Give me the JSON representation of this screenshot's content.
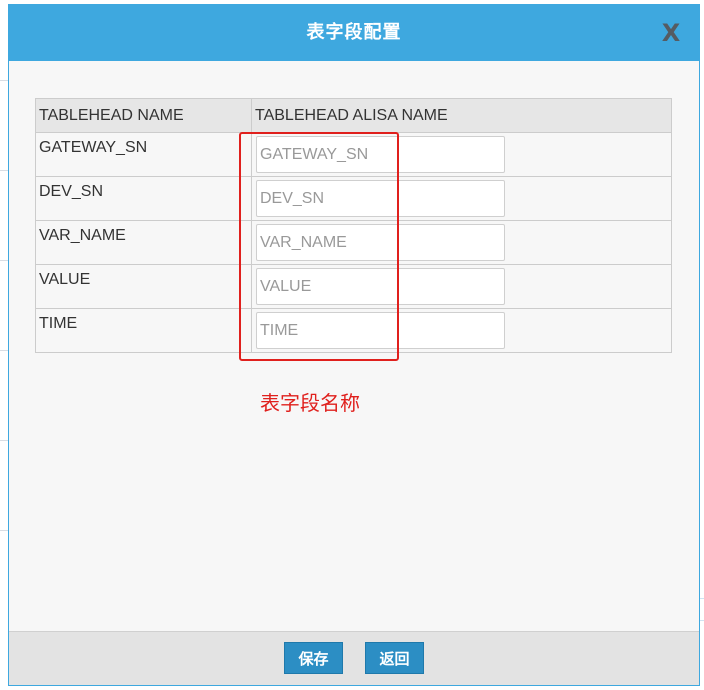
{
  "dialog": {
    "title": "表字段配置",
    "close_label": "X"
  },
  "table": {
    "headers": [
      "TABLEHEAD NAME",
      "TABLEHEAD ALISA NAME"
    ],
    "rows": [
      {
        "name": "GATEWAY_SN",
        "alias_placeholder": "GATEWAY_SN",
        "alias_value": ""
      },
      {
        "name": "DEV_SN",
        "alias_placeholder": "DEV_SN",
        "alias_value": ""
      },
      {
        "name": "VAR_NAME",
        "alias_placeholder": "VAR_NAME",
        "alias_value": ""
      },
      {
        "name": "VALUE",
        "alias_placeholder": "VALUE",
        "alias_value": ""
      },
      {
        "name": "TIME",
        "alias_placeholder": "TIME",
        "alias_value": ""
      }
    ]
  },
  "annotation": {
    "text": "表字段名称",
    "color": "#e0201d"
  },
  "footer": {
    "save_label": "保存",
    "back_label": "返回"
  },
  "colors": {
    "header_bg": "#3ea8df",
    "button_bg": "#2c8ec4"
  }
}
